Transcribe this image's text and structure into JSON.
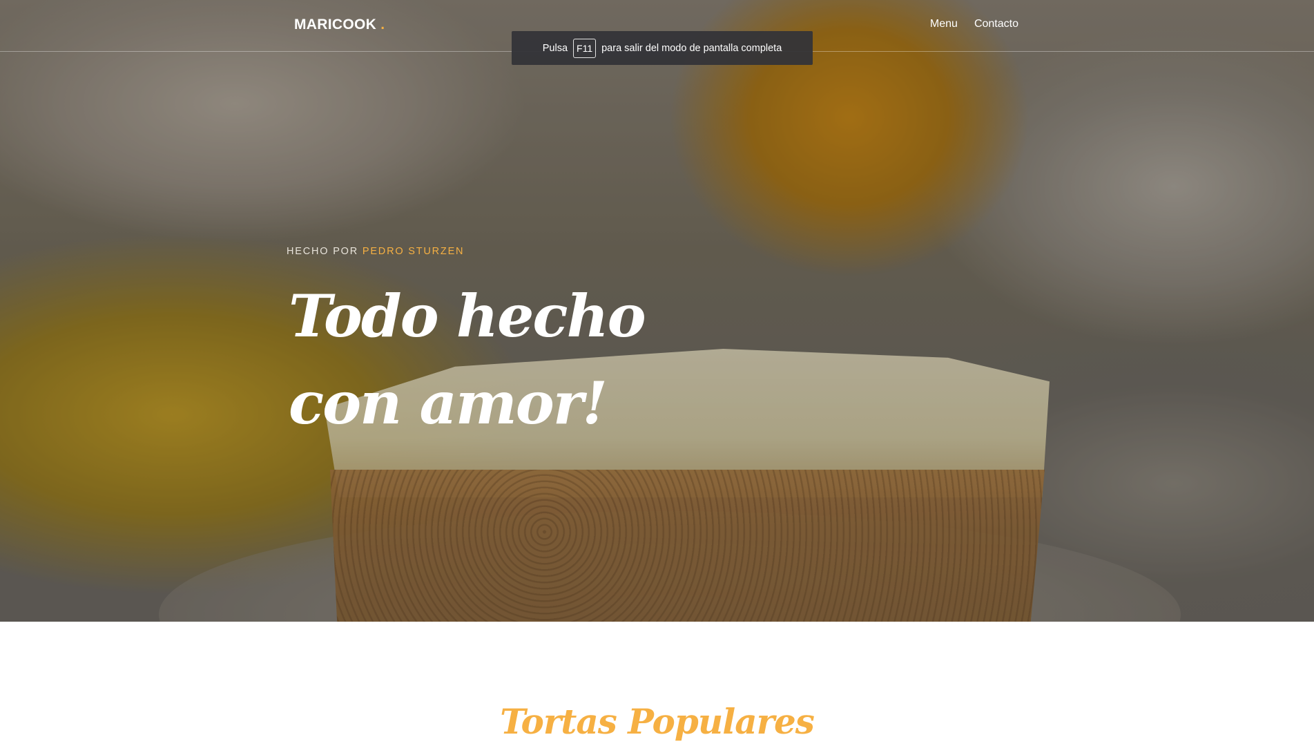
{
  "navbar": {
    "brand": "MARICOOK",
    "brand_dot": ".",
    "links": [
      "Menu",
      "Contacto"
    ]
  },
  "fullscreen_notice": {
    "prefix": "Pulsa",
    "key": "F11",
    "suffix": "para salir del modo de pantalla completa"
  },
  "hero": {
    "kicker_prefix": "HECHO POR",
    "kicker_author": "PEDRO STURZEN",
    "title": "Todo hecho con amor!"
  },
  "section": {
    "title": "Tortas Populares"
  },
  "colors": {
    "accent": "#f6b043",
    "overlay": "#343438"
  }
}
